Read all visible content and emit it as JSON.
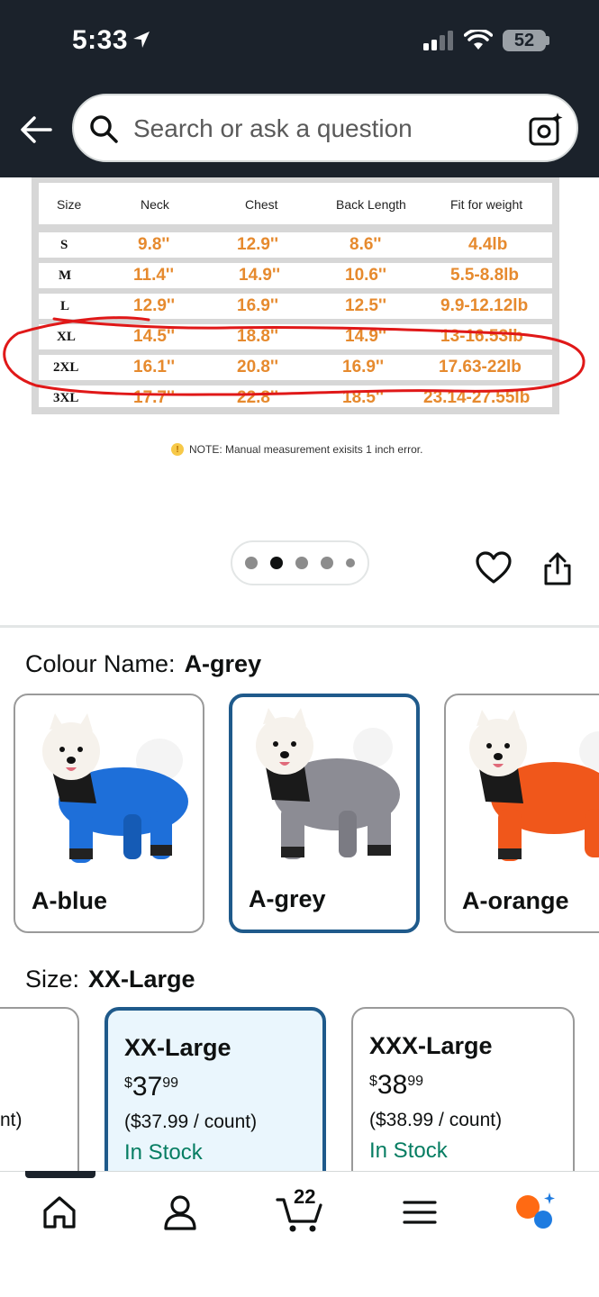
{
  "status_bar": {
    "time": "5:33",
    "battery": "52"
  },
  "search": {
    "placeholder": "Search or ask a question"
  },
  "size_chart": {
    "headers": [
      "Size",
      "Neck",
      "Chest",
      "Back Length",
      "Fit for weight"
    ],
    "rows": [
      [
        "S",
        "9.8''",
        "12.9''",
        "8.6''",
        "4.4lb"
      ],
      [
        "M",
        "11.4''",
        "14.9''",
        "10.6''",
        "5.5-8.8lb"
      ],
      [
        "L",
        "12.9''",
        "16.9''",
        "12.5''",
        "9.9-12.12lb"
      ],
      [
        "XL",
        "14.5''",
        "18.8''",
        "14.9''",
        "13-16.53lb"
      ],
      [
        "2XL",
        "16.1''",
        "20.8''",
        "16.9''",
        "17.63-22lb"
      ],
      [
        "3XL",
        "17.7''",
        "22.8''",
        "18.5''",
        "23.14-27.55lb"
      ]
    ],
    "note": "NOTE: Manual measurement exisits 1 inch error."
  },
  "colour": {
    "label": "Colour Name:",
    "selected": "A-grey",
    "options": [
      {
        "name": "A-blue",
        "color": "#1e6fd9"
      },
      {
        "name": "A-grey",
        "color": "#8c8c94"
      },
      {
        "name": "A-orange",
        "color": "#f0571b"
      }
    ]
  },
  "size": {
    "label": "Size:",
    "selected": "XX-Large",
    "options": [
      {
        "title": "",
        "per": "nt)"
      },
      {
        "title": "XX-Large",
        "price_dollars": "37",
        "price_cents": "99",
        "currency": "$",
        "per": "($37.99 / count)",
        "stock": "In Stock"
      },
      {
        "title": "XXX-Large",
        "price_dollars": "38",
        "price_cents": "99",
        "currency": "$",
        "per": "($38.99 / count)",
        "stock": "In Stock"
      }
    ]
  },
  "bottom_nav": {
    "cart_count": "22"
  }
}
